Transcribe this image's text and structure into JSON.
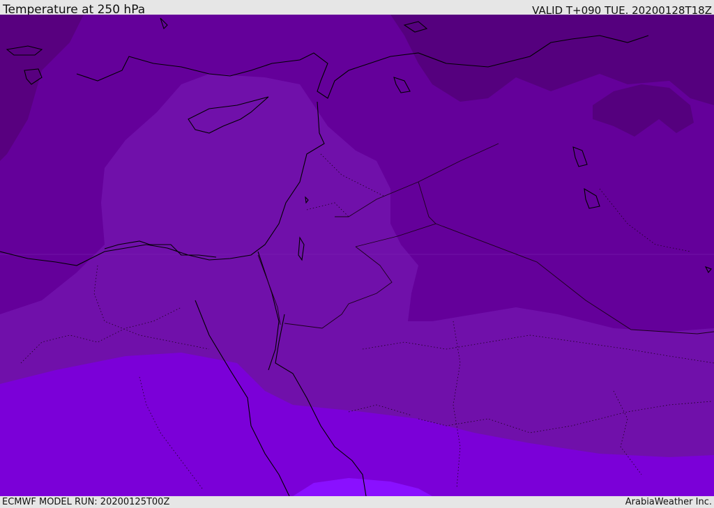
{
  "header": {
    "title": "Temperature at 250 hPa",
    "valid": "VALID T+090 TUE. 20200128T18Z"
  },
  "footer": {
    "model_run": "ECMWF MODEL RUN: 20200125T00Z",
    "credit": "ArabiaWeather Inc."
  },
  "colors": {
    "band_coldest": "#55007e",
    "band_cold": "#62008f",
    "band_mid": "#7010aa",
    "band_warm": "#7b00d8",
    "band_warmest": "#8000f0",
    "coastline": "#000000",
    "border": "#1a001a"
  }
}
